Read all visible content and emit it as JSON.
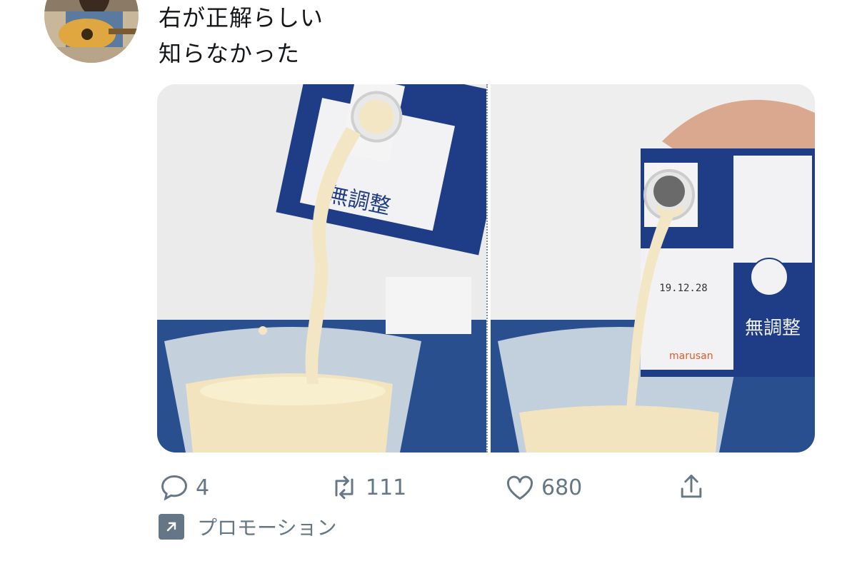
{
  "tweet": {
    "lines": [
      "右が正解らしい",
      "知らなかった"
    ]
  },
  "media": {
    "left_image": "soy milk pouring with spout at top",
    "right_image": "soy milk pouring with spout at bottom",
    "carton_text_left": "無調整",
    "carton_text_right": "無調整",
    "carton_brand": "marusan",
    "date_code": "19.12.28"
  },
  "actions": {
    "replies": "4",
    "retweets": "111",
    "likes": "680"
  },
  "promo": {
    "label": "プロモーション"
  },
  "colors": {
    "icon_gray": "#657786",
    "carton_blue": "#1f3c86",
    "milk": "#f2e6c4"
  }
}
